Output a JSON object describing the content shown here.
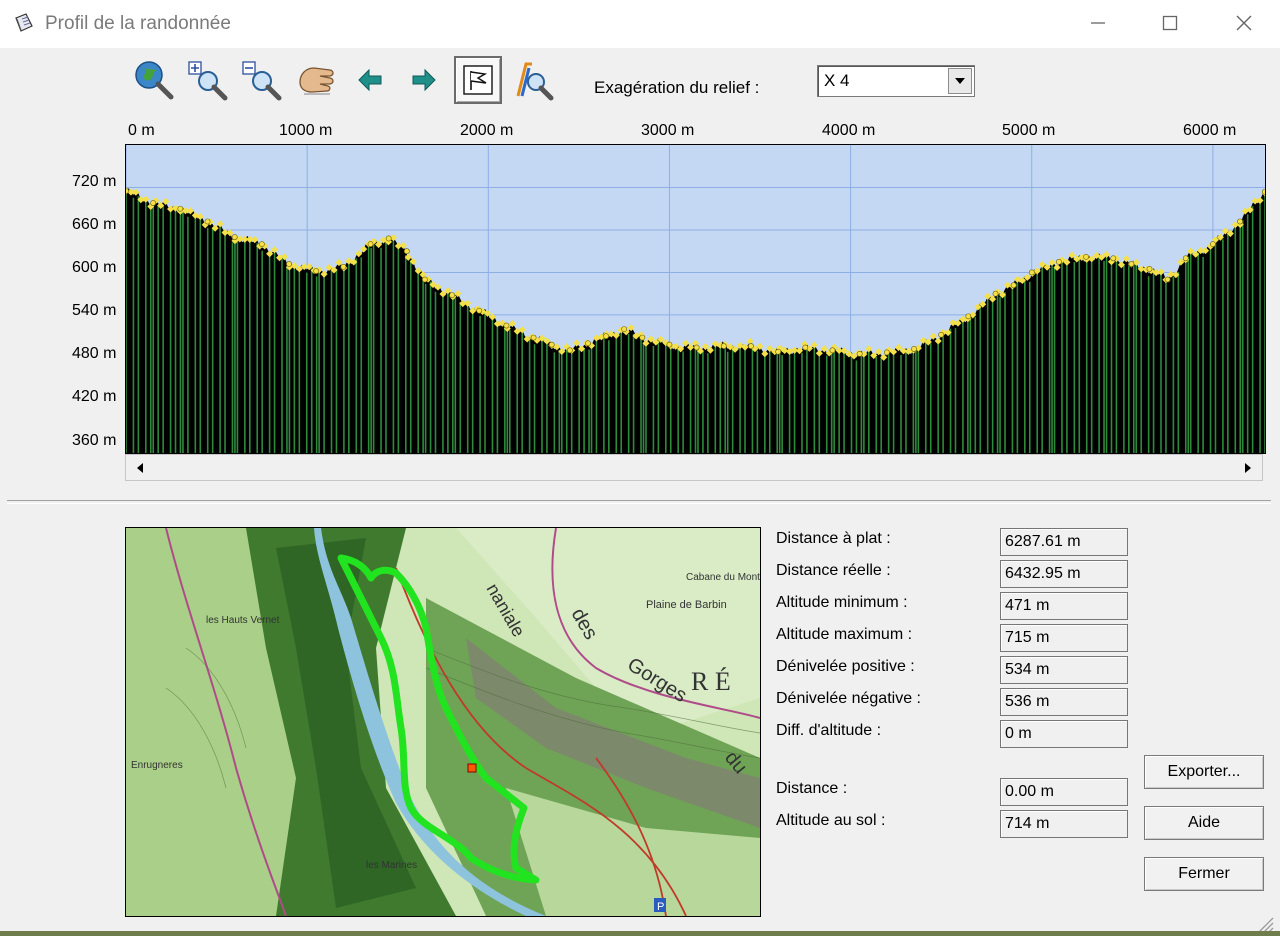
{
  "window": {
    "title": "Profil de la randonnée",
    "icon": "notepad-icon"
  },
  "toolbar": {
    "tools": [
      {
        "name": "globe-zoom-icon"
      },
      {
        "name": "zoom-in-icon"
      },
      {
        "name": "zoom-out-icon"
      },
      {
        "name": "pan-hand-icon"
      },
      {
        "name": "arrow-left-icon"
      },
      {
        "name": "arrow-right-icon"
      },
      {
        "name": "flag-icon",
        "active": true
      },
      {
        "name": "profile-zoom-icon"
      }
    ],
    "exaggeration_label": "Exagération du relief :",
    "exaggeration_value": "X 4"
  },
  "profile": {
    "x_ticks": [
      "0 m",
      "1000 m",
      "2000 m",
      "3000 m",
      "4000 m",
      "5000 m",
      "6000 m"
    ],
    "y_ticks": [
      "720 m",
      "660 m",
      "600 m",
      "540 m",
      "480 m",
      "420 m",
      "360 m"
    ],
    "colors": {
      "sky": "#c4d8f4",
      "grid": "#8eaee6",
      "ground": "#000000",
      "stripes": "#2f8a3c",
      "points": "#f3e04a"
    }
  },
  "chart_data": {
    "type": "area",
    "x_unit": "m",
    "y_unit": "m",
    "xlim": [
      0,
      6287.61
    ],
    "ylim": [
      345,
      780
    ],
    "x": [
      0,
      150,
      300,
      450,
      600,
      750,
      900,
      1050,
      1200,
      1350,
      1450,
      1550,
      1650,
      1800,
      1950,
      2100,
      2250,
      2350,
      2450,
      2550,
      2650,
      2750,
      2850,
      3000,
      3150,
      3300,
      3450,
      3600,
      3750,
      3900,
      4050,
      4200,
      4350,
      4500,
      4650,
      4800,
      4900,
      5000,
      5150,
      5300,
      5450,
      5550,
      5650,
      5750,
      5850,
      6000,
      6150,
      6287
    ],
    "y": [
      715,
      698,
      690,
      672,
      650,
      640,
      612,
      602,
      608,
      640,
      648,
      630,
      590,
      568,
      546,
      525,
      508,
      498,
      490,
      500,
      510,
      520,
      508,
      498,
      494,
      496,
      496,
      488,
      494,
      490,
      485,
      487,
      492,
      512,
      538,
      570,
      582,
      600,
      615,
      622,
      620,
      612,
      605,
      590,
      620,
      640,
      672,
      714
    ]
  },
  "map": {
    "alt_text": "Carte topographique de l'itinéraire",
    "labels": [
      "Gorges",
      "R É",
      "des",
      "du",
      "Plaine de Barbin",
      "Cabane du Mont",
      "les Hauts Vernet",
      "Enrugneres",
      "les Marines"
    ]
  },
  "stats": [
    {
      "label": "Distance à plat :",
      "value": "6287.61 m"
    },
    {
      "label": "Distance réelle :",
      "value": "6432.95 m"
    },
    {
      "label": "Altitude minimum :",
      "value": "471 m"
    },
    {
      "label": "Altitude maximum :",
      "value": "715 m"
    },
    {
      "label": "Dénivelée positive :",
      "value": "534 m"
    },
    {
      "label": "Dénivelée négative :",
      "value": "536 m"
    },
    {
      "label": "Diff. d'altitude :",
      "value": "0 m"
    }
  ],
  "cursor": [
    {
      "label": "Distance :",
      "value": "0.00 m"
    },
    {
      "label": "Altitude au sol :",
      "value": "714 m"
    }
  ],
  "buttons": {
    "export": "Exporter...",
    "help": "Aide",
    "close": "Fermer"
  }
}
